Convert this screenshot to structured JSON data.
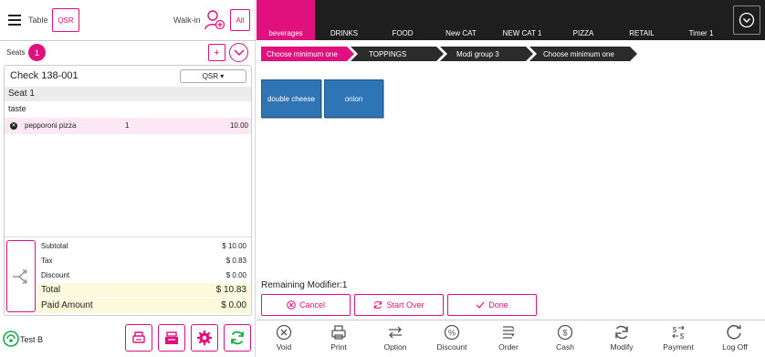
{
  "header": {
    "table_label": "Table",
    "order_type": "QSR",
    "walkin_label": "Walk-in",
    "all_label": "All"
  },
  "seats": {
    "label": "Seats",
    "count": "1",
    "add_label": "+"
  },
  "check": {
    "title": "Check 138-001",
    "type_select": "QSR ▾",
    "seat_header": "Seat 1",
    "note": "taste",
    "items": [
      {
        "name": "pepporoni pizza",
        "qty": "1",
        "price": "10.00"
      }
    ],
    "totals": [
      {
        "label": "Subtotal",
        "value": "$ 10.00"
      },
      {
        "label": "Tax",
        "value": "$ 0.83"
      },
      {
        "label": "Discount",
        "value": "$ 0.00"
      },
      {
        "label": "Total",
        "value": "$ 10.83"
      },
      {
        "label": "Paid Amount",
        "value": "$ 0.00"
      }
    ]
  },
  "user": {
    "name": "Test B"
  },
  "categories": [
    {
      "label": "beverages",
      "active": true
    },
    {
      "label": "DRINKS"
    },
    {
      "label": "FOOD"
    },
    {
      "label": "New CAT"
    },
    {
      "label": "NEW CAT 1"
    },
    {
      "label": "PIZZA"
    },
    {
      "label": "RETAIL"
    },
    {
      "label": "Timer 1"
    }
  ],
  "modifier_groups": [
    {
      "label": "Choose minimum one",
      "active": true
    },
    {
      "label": "TOPPINGS"
    },
    {
      "label": "Modi group 3"
    },
    {
      "label": "Choose minimum one"
    }
  ],
  "modifiers": [
    {
      "label": "double cheese"
    },
    {
      "label": "onion"
    }
  ],
  "remaining": "Remaining Modifier:1",
  "controls": {
    "cancel": "Cancel",
    "start_over": "Start Over",
    "done": "Done"
  },
  "toolbar": [
    {
      "label": "Void",
      "icon": "void-icon"
    },
    {
      "label": "Print",
      "icon": "print-icon"
    },
    {
      "label": "Option",
      "icon": "option-icon"
    },
    {
      "label": "Discount",
      "icon": "discount-icon"
    },
    {
      "label": "Order",
      "icon": "order-icon"
    },
    {
      "label": "Cash",
      "icon": "cash-icon"
    },
    {
      "label": "Modify",
      "icon": "modify-icon"
    },
    {
      "label": "Payment",
      "icon": "payment-icon"
    },
    {
      "label": "Log Off",
      "icon": "logoff-icon"
    }
  ],
  "colors": {
    "accent": "#e0107e",
    "category_bar": "#1e1e1e",
    "modifier_button": "#2f74b5"
  }
}
